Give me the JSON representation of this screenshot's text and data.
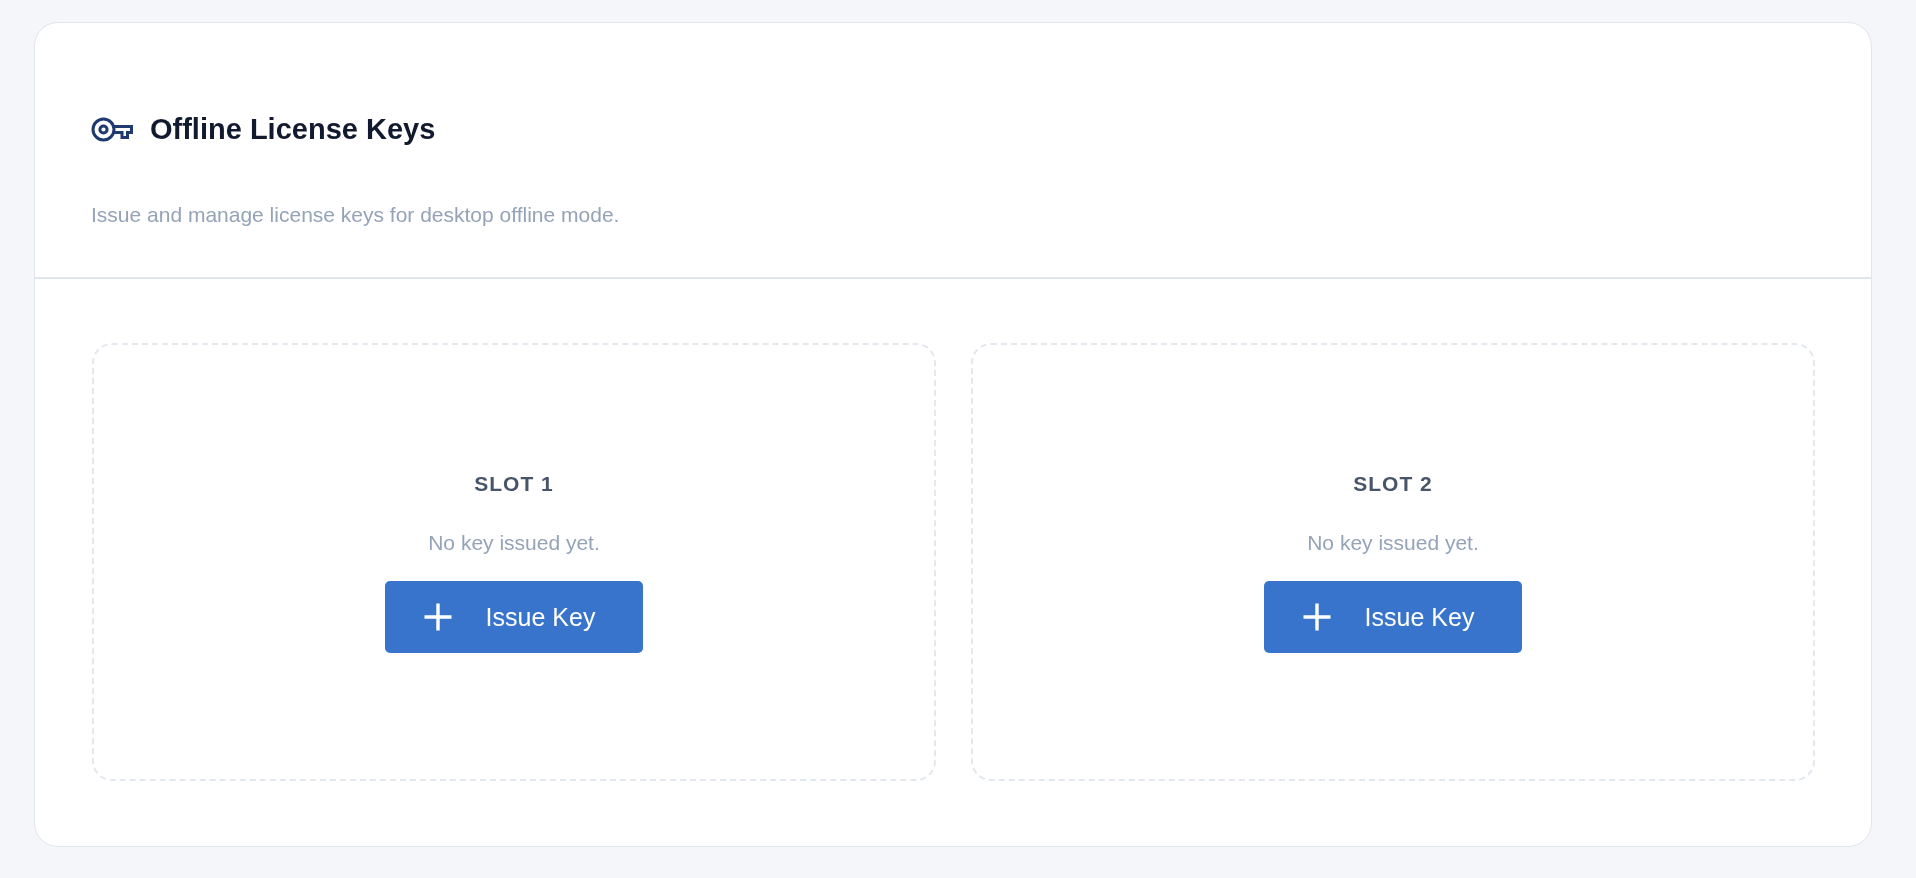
{
  "header": {
    "title": "Offline License Keys",
    "subtitle": "Issue and manage license keys for desktop offline mode."
  },
  "slots": [
    {
      "label": "SLOT 1",
      "status": "No key issued yet.",
      "button": {
        "label": "Issue Key"
      }
    },
    {
      "label": "SLOT 2",
      "status": "No key issued yet.",
      "button": {
        "label": "Issue Key"
      }
    }
  ]
}
